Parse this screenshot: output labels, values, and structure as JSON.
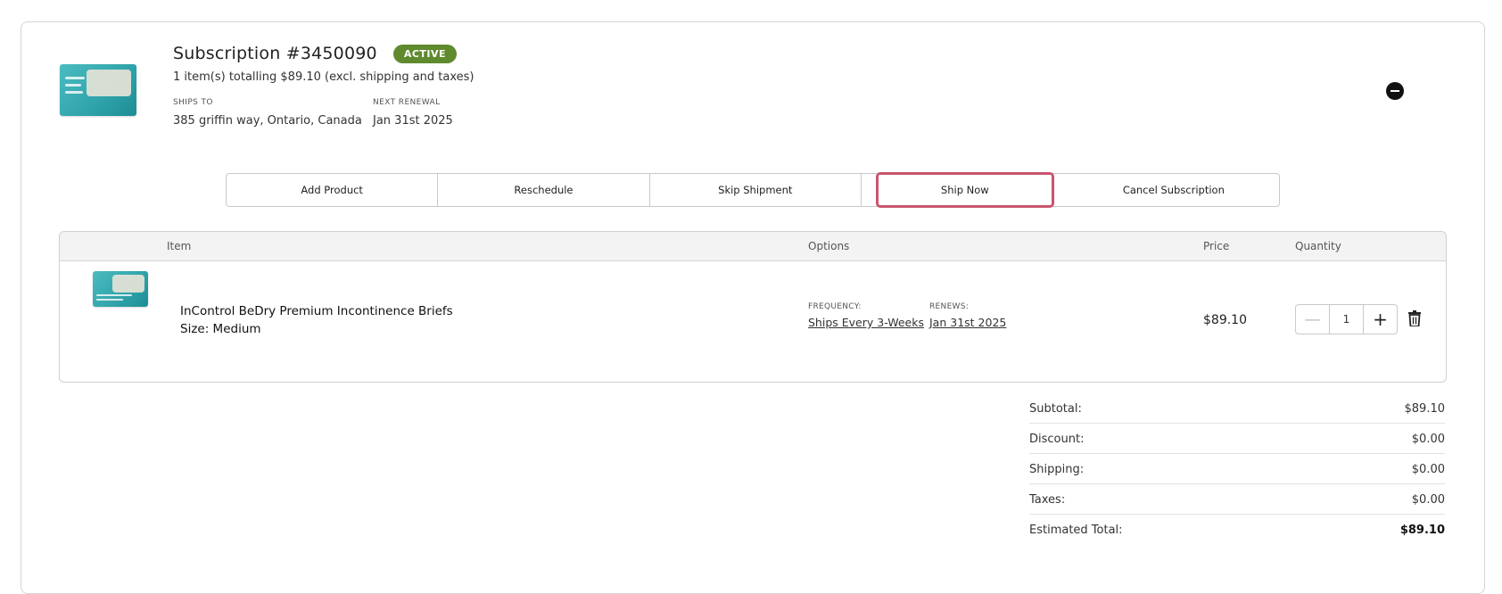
{
  "subscription": {
    "title": "Subscription #3450090",
    "status": "ACTIVE",
    "summary": "1 item(s) totalling $89.10 (excl. shipping and taxes)",
    "ships_to_label": "SHIPS TO",
    "ships_to_value": "385 griffin way, Ontario, Canada",
    "next_renewal_label": "NEXT RENEWAL",
    "next_renewal_value": "Jan 31st 2025"
  },
  "actions": {
    "add_product": "Add Product",
    "reschedule": "Reschedule",
    "skip_shipment": "Skip Shipment",
    "ship_now": "Ship Now",
    "cancel_subscription": "Cancel Subscription"
  },
  "table": {
    "headers": {
      "item": "Item",
      "options": "Options",
      "price": "Price",
      "quantity": "Quantity"
    },
    "row": {
      "name": "InControl BeDry Premium Incontinence Briefs",
      "size": "Size: Medium",
      "frequency_label": "FREQUENCY:",
      "frequency_value": "Ships Every 3-Weeks",
      "renews_label": "RENEWS:",
      "renews_value": "Jan 31st 2025",
      "price": "$89.10",
      "quantity": "1"
    }
  },
  "totals": {
    "subtotal_label": "Subtotal:",
    "subtotal_value": "$89.10",
    "discount_label": "Discount:",
    "discount_value": "$0.00",
    "shipping_label": "Shipping:",
    "shipping_value": "$0.00",
    "taxes_label": "Taxes:",
    "taxes_value": "$0.00",
    "estimated_label": "Estimated Total:",
    "estimated_value": "$89.10"
  },
  "colors": {
    "badge": "#5f8a2e",
    "highlight": "#c9566e",
    "product_teal": "#2fa3aa"
  },
  "icons": {
    "collapse": "minus-circle-icon",
    "decrement": "minus-icon",
    "increment": "plus-icon",
    "delete": "trash-icon"
  }
}
